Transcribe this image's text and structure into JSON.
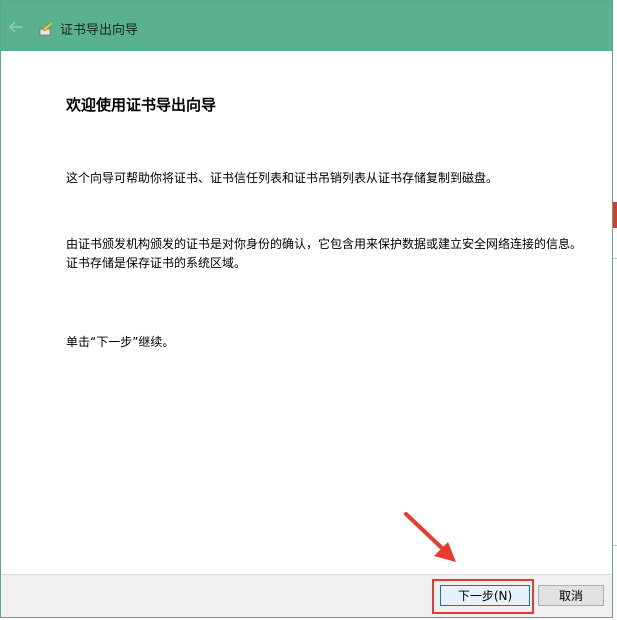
{
  "window": {
    "title": "证书导出向导"
  },
  "content": {
    "heading": "欢迎使用证书导出向导",
    "paragraph1": "这个向导可帮助你将证书、证书信任列表和证书吊销列表从证书存储复制到磁盘。",
    "paragraph2": "由证书颁发机构颁发的证书是对你身份的确认，它包含用来保护数据或建立安全网络连接的信息。证书存储是保存证书的系统区域。",
    "paragraph3": "单击“下一步”继续。"
  },
  "footer": {
    "next_label": "下一步(N)",
    "cancel_label": "取消"
  },
  "colors": {
    "titlebar": "#59b18e",
    "highlight": "#e53935"
  }
}
